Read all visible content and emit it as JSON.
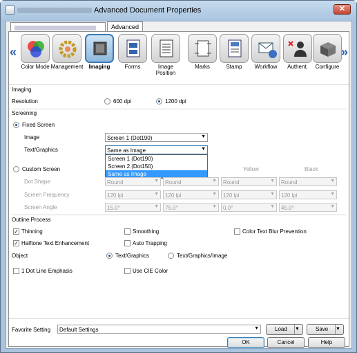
{
  "window": {
    "title": "Advanced Document Properties",
    "close_glyph": "✕"
  },
  "tabs": {
    "advanced": "Advanced"
  },
  "ribbon": {
    "left_arrow": "«",
    "right_arrow": "»",
    "items": [
      {
        "label": "Color Mode",
        "icon": "color-mode-icon"
      },
      {
        "label": "Management",
        "icon": "management-icon"
      },
      {
        "label": "Imaging",
        "icon": "imaging-icon",
        "active": true
      },
      {
        "label": "Forms",
        "icon": "forms-icon"
      },
      {
        "label": "Image Position",
        "icon": "image-position-icon"
      },
      {
        "label": "Marks",
        "icon": "marks-icon"
      },
      {
        "label": "Stamp",
        "icon": "stamp-icon"
      },
      {
        "label": "Workflow",
        "icon": "workflow-icon"
      },
      {
        "label": "Authent.",
        "icon": "authentication-icon"
      },
      {
        "label": "Configure",
        "icon": "configure-icon"
      }
    ]
  },
  "imaging": {
    "section": "Imaging",
    "resolution_label": "Resolution",
    "res_600": "600 dpi",
    "res_1200": "1200 dpi",
    "selected_resolution": "1200 dpi"
  },
  "screening": {
    "section": "Screening",
    "fixed_screen": "Fixed Screen",
    "image_label": "Image",
    "image_value": "Screen 1 (Dot190)",
    "text_graphics_label": "Text/Graphics",
    "text_graphics_value": "Same as Image",
    "dropdown_options": [
      "Screen 1 (Dot190)",
      "Screen 2 (Dot150)",
      "Same as Image"
    ],
    "highlighted_option": "Same as Image",
    "custom_screen": "Custom Screen",
    "columns": [
      "Yellow",
      "Black"
    ],
    "dot_shape_label": "Dot Shape",
    "dot_shape_values": [
      "Round",
      "Round",
      "Round",
      "Round"
    ],
    "frequency_label": "Screen Frequency",
    "frequency_values": [
      "120 lpi",
      "120 lpi",
      "120 lpi",
      "120 lpi"
    ],
    "angle_label": "Screen Angle",
    "angle_values": [
      "15.0°",
      "75.0°",
      "0.0°",
      "45.0°"
    ]
  },
  "outline": {
    "section": "Outline Process",
    "thinning": "Thinning",
    "smoothing": "Smoothing",
    "color_blur": "Color Text Blur Prevention",
    "halftone": "Halftone Text Enhancement",
    "auto_trapping": "Auto Trapping",
    "object_label": "Object",
    "obj_text_graphics": "Text/Graphics",
    "obj_text_graphics_image": "Text/Graphics/Image",
    "dot_line": "1 Dot Line Emphasis",
    "use_cie": "Use CIE Color",
    "check": "✓"
  },
  "footer": {
    "favorite_label": "Favorite Setting",
    "favorite_value": "Default Settings",
    "load": "Load",
    "save": "Save",
    "ok": "OK",
    "cancel": "Cancel",
    "help": "Help"
  },
  "colors": {
    "accent": "#3399ff",
    "title_bar": "#aac4de"
  }
}
